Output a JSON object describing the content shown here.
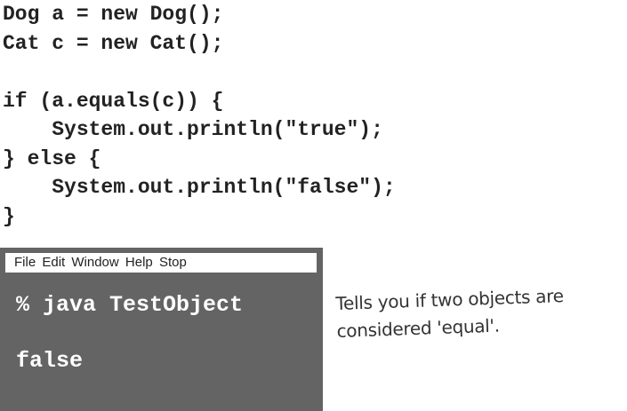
{
  "code": {
    "lines": [
      "Dog a = new Dog();",
      "Cat c = new Cat();",
      "",
      "if (a.equals(c)) {",
      "    System.out.println(\"true\");",
      "} else {",
      "    System.out.println(\"false\");",
      "}"
    ]
  },
  "terminal": {
    "menu": [
      "File",
      "Edit",
      "Window",
      "Help",
      "Stop"
    ],
    "command": "% java TestObject",
    "output": "false",
    "background": "#646464"
  },
  "note": {
    "lines": [
      "Tells you if two objects are",
      "considered 'equal'."
    ]
  }
}
